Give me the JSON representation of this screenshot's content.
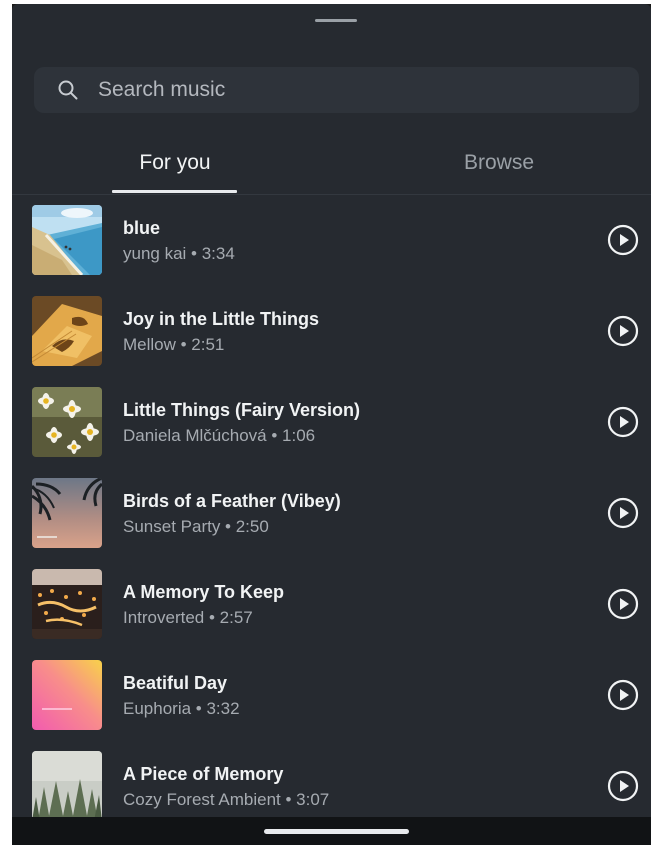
{
  "search": {
    "placeholder": "Search music",
    "icon": "search-icon"
  },
  "tabs": [
    {
      "label": "For you",
      "selected": true
    },
    {
      "label": "Browse",
      "selected": false
    }
  ],
  "tracks": [
    {
      "title": "blue",
      "artist": "yung kai",
      "duration": "3:34",
      "meta": "yung kai • 3:34",
      "art": "beach-art"
    },
    {
      "title": "Joy in the Little Things",
      "artist": "Mellow",
      "duration": "2:51",
      "meta": "Mellow • 2:51",
      "art": "book-shadow-art"
    },
    {
      "title": "Little Things (Fairy Version)",
      "artist": "Daniela Mlčúchová",
      "duration": "1:06",
      "meta": "Daniela Mlčúchová • 1:06",
      "art": "daisies-art"
    },
    {
      "title": "Birds of a Feather (Vibey)",
      "artist": "Sunset Party",
      "duration": "2:50",
      "meta": "Sunset Party • 2:50",
      "art": "palm-sunset-art"
    },
    {
      "title": "A Memory To Keep",
      "artist": "Introverted",
      "duration": "2:57",
      "meta": "Introverted • 2:57",
      "art": "lights-art"
    },
    {
      "title": "Beatiful Day",
      "artist": "Euphoria",
      "duration": "3:32",
      "meta": "Euphoria • 3:32",
      "art": "gradient-art"
    },
    {
      "title": "A Piece of Memory",
      "artist": "Cozy Forest Ambient",
      "duration": "3:07",
      "meta": "Cozy Forest Ambient • 3:07",
      "art": "forest-art"
    }
  ],
  "colors": {
    "background": "#262a30",
    "search_field": "#2e333a",
    "text_primary": "#f1f3f4",
    "text_secondary": "#a6abb1"
  }
}
